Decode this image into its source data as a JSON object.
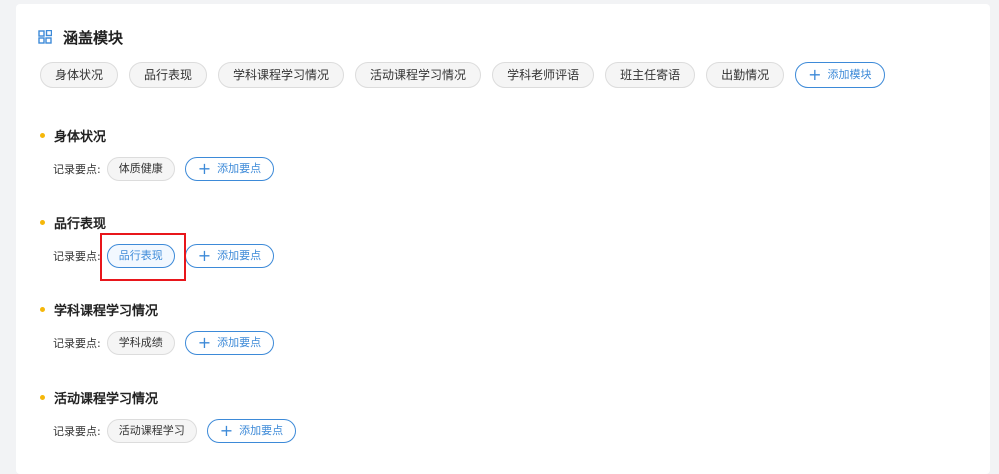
{
  "header": {
    "title": "涵盖模块",
    "icon": "module-grid-icon"
  },
  "modules": {
    "tags": [
      "身体状况",
      "品行表现",
      "学科课程学习情况",
      "活动课程学习情况",
      "学科老师评语",
      "班主任寄语",
      "出勤情况"
    ],
    "add_label": "添加模块"
  },
  "sections": [
    {
      "title": "身体状况",
      "points_label": "记录要点:",
      "points": [
        "体质健康"
      ],
      "add_label": "添加要点"
    },
    {
      "title": "品行表现",
      "points_label": "记录要点:",
      "points": [
        "品行表现"
      ],
      "add_label": "添加要点"
    },
    {
      "title": "学科课程学习情况",
      "points_label": "记录要点:",
      "points": [
        "学科成绩"
      ],
      "add_label": "添加要点"
    },
    {
      "title": "活动课程学习情况",
      "points_label": "记录要点:",
      "points": [
        "活动课程学习"
      ],
      "add_label": "添加要点"
    }
  ],
  "colors": {
    "accent": "#3d8ad8",
    "bullet": "#f5b70a",
    "highlight": "#e8161b"
  }
}
